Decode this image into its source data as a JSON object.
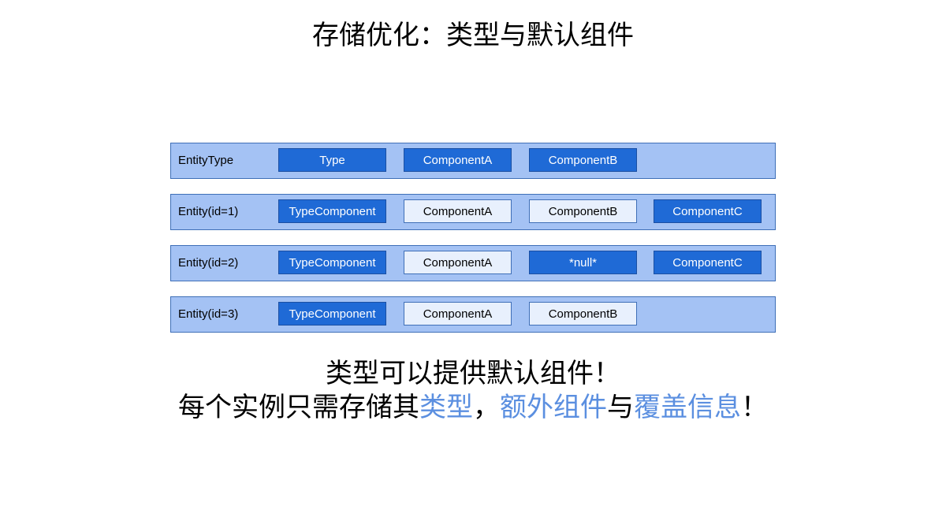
{
  "title": "存储优化：类型与默认组件",
  "colors": {
    "row_bg": "#a4c2f4",
    "cell_dark": "#1f6ad6",
    "cell_light": "#e8f0fd",
    "highlight_text": "#5b8fe0"
  },
  "rows": [
    {
      "label": "EntityType",
      "cells": [
        {
          "text": "Type",
          "style": "dark"
        },
        {
          "text": "ComponentA",
          "style": "dark"
        },
        {
          "text": "ComponentB",
          "style": "dark"
        }
      ]
    },
    {
      "label": "Entity(id=1)",
      "cells": [
        {
          "text": "TypeComponent",
          "style": "dark"
        },
        {
          "text": "ComponentA",
          "style": "light"
        },
        {
          "text": "ComponentB",
          "style": "light"
        },
        {
          "text": "ComponentC",
          "style": "dark"
        }
      ]
    },
    {
      "label": "Entity(id=2)",
      "cells": [
        {
          "text": "TypeComponent",
          "style": "dark"
        },
        {
          "text": "ComponentA",
          "style": "light"
        },
        {
          "text": "*null*",
          "style": "dark"
        },
        {
          "text": "ComponentC",
          "style": "dark"
        }
      ]
    },
    {
      "label": "Entity(id=3)",
      "cells": [
        {
          "text": "TypeComponent",
          "style": "dark"
        },
        {
          "text": "ComponentA",
          "style": "light"
        },
        {
          "text": "ComponentB",
          "style": "light"
        }
      ]
    }
  ],
  "caption": {
    "line1": "类型可以提供默认组件！",
    "line2": {
      "part1": "每个实例只需存储其",
      "hl1": "类型",
      "part2": "，",
      "hl2": "额外组件",
      "part3": "与",
      "hl3": "覆盖信息",
      "part4": "！"
    }
  }
}
